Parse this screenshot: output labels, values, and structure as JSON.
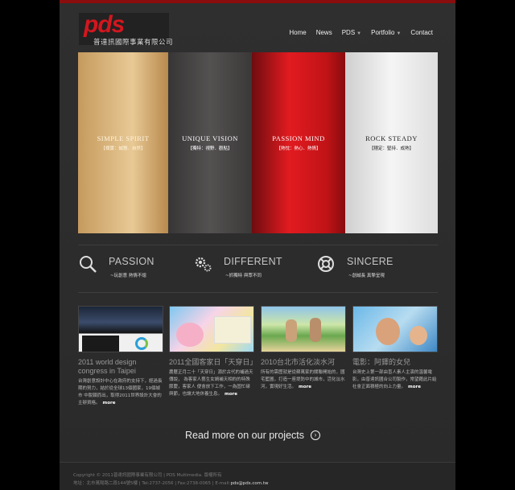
{
  "brand": {
    "logo_text": "pds",
    "company": "普達訊國際事業有限公司"
  },
  "nav": {
    "items": [
      {
        "label": "Home"
      },
      {
        "label": "News"
      },
      {
        "label": "PDS"
      },
      {
        "label": "Portfolio"
      },
      {
        "label": "Contact"
      }
    ]
  },
  "banner": {
    "panels": [
      {
        "title": "SIMPLE SPIRIT",
        "subtitle": "【樸實：誠懇．自然】"
      },
      {
        "title": "UNIQUE VISION",
        "subtitle": "【獨特：視野．觀點】"
      },
      {
        "title": "PASSION MIND",
        "subtitle": "【熱忱：熱心．熱情】"
      },
      {
        "title": "ROCK STEADY",
        "subtitle": "【穩定：堅持．成熟】"
      }
    ]
  },
  "values": [
    {
      "icon": "search-icon",
      "title": "PASSION",
      "subtitle": "~玩創意 熱情不熄"
    },
    {
      "icon": "gears-icon",
      "title": "DIFFERENT",
      "subtitle": "~抓獨特 與眾不同"
    },
    {
      "icon": "lifebuoy-icon",
      "title": "SINCERE",
      "subtitle": "~創誠長 真摯呈現"
    }
  ],
  "projects": [
    {
      "title": "2011 world design congress in Taipei",
      "desc": "台灣創意設計中心在政府的支持下，經過長期的努力，結於從全球13個國家，19個城市 中脫穎而出，取得2011世界設計大會的主辦資格。",
      "more": "more"
    },
    {
      "title": "2011全國客家日「天穿日」",
      "desc": "農曆正月二十「天穿日」源於古代的補過天傳說， 為客家人藝生女媧補天相約的特殊節慶，客家人 便會放下工作，一為固忙碌與節，也讓大地休養生息。",
      "more": "more"
    },
    {
      "title": "2010台北市活化淡水河",
      "desc": "所有的需歷就是從蘇萬家的關聯開始的，國宅籃圖，打造一座堤防中的城市，活化淡水河，實現好生活。",
      "more": "more"
    },
    {
      "title": "電影：阿鐸的女兒",
      "desc": "台灣史上第一部由盲人素人主演的溫馨電影，由普達訊國合公司製作，常望藉此片給社會正面積極的向上力量。",
      "more": "more"
    }
  ],
  "readmore": {
    "label": "Read more on our projects"
  },
  "footer": {
    "copyright": "Copyright © 2011普達訊國際事業有限公司 | PDS Multimedia. 版權所有",
    "address": "地址：北市萬陽路二段144號5樓 | Tel:2737-2056 | Fax:2738-0065 | E-mail:",
    "email": "pds@pds.com.tw"
  },
  "colors": {
    "brand_red": "#d4161e",
    "background": "#000000",
    "content": "#2f2f2f"
  }
}
